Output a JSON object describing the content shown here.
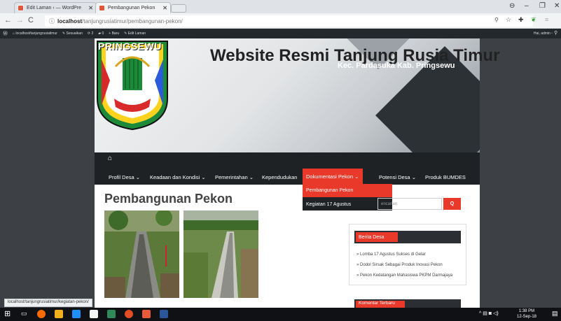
{
  "browser": {
    "tabs": [
      {
        "label": "Edit Laman ‹ — WordPre",
        "active": false
      },
      {
        "label": "Pembangunan Pekon",
        "active": true
      }
    ],
    "url_host": "localhost",
    "url_path": "/tanjungrusiatimur/pembangunan-pekon/"
  },
  "adminbar": {
    "site": "localhost/tanjungrusiatimur",
    "customize": "Sesuaikan",
    "updates": "2",
    "comments": "0",
    "new": "Baru",
    "edit": "Edit Laman",
    "greeting": "Hai, admin"
  },
  "site": {
    "logo_text": "PRINGSEWU",
    "title": "Website Resmi Tanjung Rusia Timur",
    "tagline": "Kec. Pardasuka Kab. Pringsewu"
  },
  "nav": {
    "items": [
      "Profil Desa ⌄",
      "Keadaan dan Kondisi ⌄",
      "Pemerintahan ⌄",
      "Kependudukan",
      "Dokumentasi Pekon ⌄",
      "Potensi Desa ⌄",
      "Produk BUMDES"
    ],
    "dropdown": [
      "Pembangunan Pekon",
      "Kegiatan 17 Agustus"
    ]
  },
  "main": {
    "page_title": "Pembangunan Pekon"
  },
  "sidebar": {
    "search_placeholder": "encarian",
    "search_button": "Q",
    "berita_title": "Berita Desa",
    "posts": [
      "Lomba 17 Agustus Sukses di Gelar",
      "Dodol Sirsak Sebagai Produk Inovasi Pekon",
      "Pekon Kedatangan Mahasiswa PKPM Darmajaya"
    ],
    "komentar_title": "Komentar Terbaru"
  },
  "status_bar": "localhost/tanjungrusiatimur/kegiatan-pekon/",
  "taskbar": {
    "time": "1:38 PM",
    "date": "12-Sep-18"
  },
  "colors": {
    "accent": "#e8392b",
    "nav_bg": "#1f2224",
    "page_bg": "#3d4045"
  }
}
